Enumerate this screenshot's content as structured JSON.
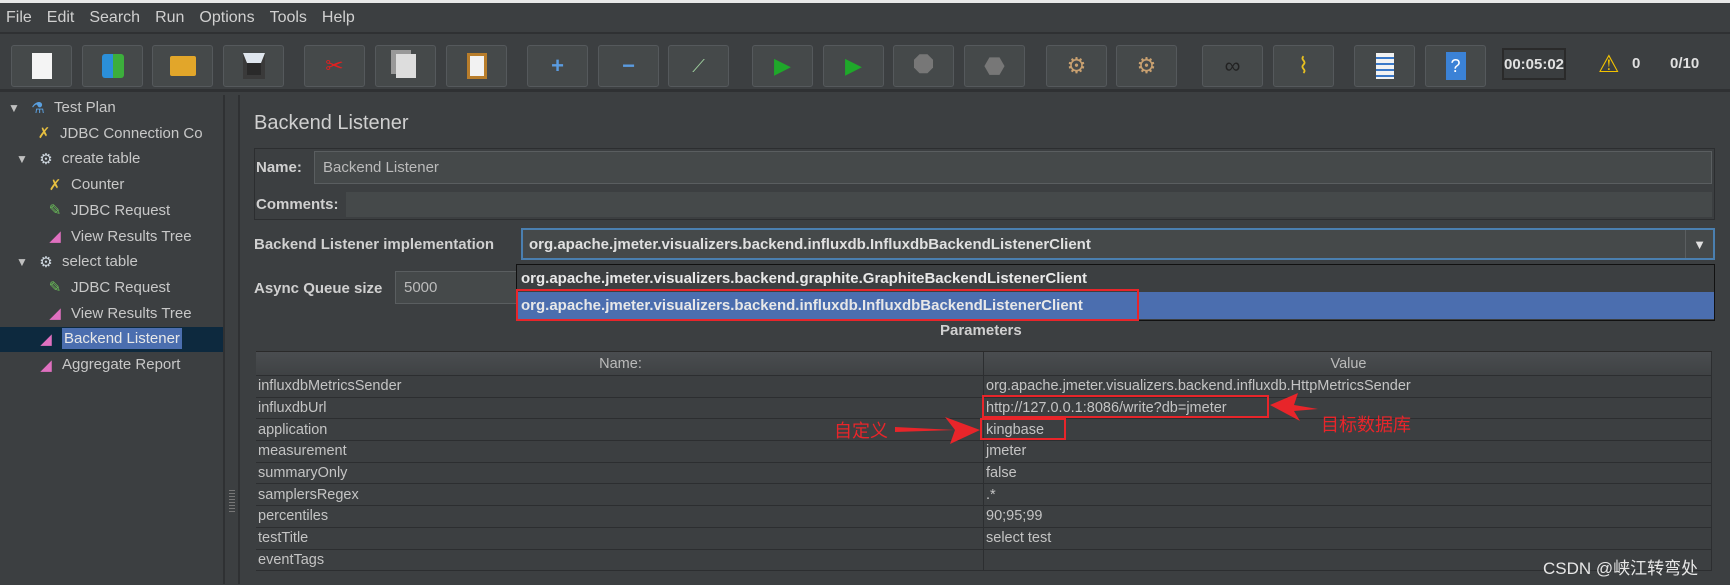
{
  "menu": [
    "File",
    "Edit",
    "Search",
    "Run",
    "Options",
    "Tools",
    "Help"
  ],
  "toolbar": {
    "buttons": [
      "new-icon",
      "templates-icon",
      "open-icon",
      "save-icon",
      "cut-icon",
      "copy-icon",
      "paste-icon",
      "expand-icon",
      "collapse-icon",
      "toggle-icon",
      "start-icon",
      "start-no-pauses-icon",
      "stop-icon",
      "shutdown-icon",
      "clear-icon",
      "clear-all-icon",
      "search-icon",
      "reset-search-icon",
      "function-helper-icon",
      "help-icon"
    ],
    "timer": "00:05:02",
    "warning_count": "0",
    "threads": "0/10"
  },
  "tree": {
    "items": [
      {
        "label": "Test Plan",
        "icon": "test-plan-flask-icon"
      },
      {
        "label": "JDBC Connection Co",
        "icon": "config-wrench-icon"
      },
      {
        "label": "create table",
        "icon": "thread-group-gear-icon"
      },
      {
        "label": "Counter",
        "icon": "config-wrench-icon"
      },
      {
        "label": "JDBC Request",
        "icon": "sampler-pipette-icon"
      },
      {
        "label": "View Results Tree",
        "icon": "listener-chart-icon"
      },
      {
        "label": "select table",
        "icon": "thread-group-gear-icon"
      },
      {
        "label": "JDBC Request",
        "icon": "sampler-pipette-icon"
      },
      {
        "label": "View Results Tree",
        "icon": "listener-chart-icon"
      },
      {
        "label": "Backend Listener",
        "icon": "listener-chart-icon"
      },
      {
        "label": "Aggregate Report",
        "icon": "listener-chart-icon"
      }
    ],
    "selected": "Backend Listener"
  },
  "panel": {
    "title": "Backend Listener",
    "name_label": "Name:",
    "name_value": "Backend Listener",
    "comments_label": "Comments:",
    "impl_label": "Backend Listener implementation",
    "impl_value": "org.apache.jmeter.visualizers.backend.influxdb.InfluxdbBackendListenerClient",
    "impl_options": [
      "org.apache.jmeter.visualizers.backend.graphite.GraphiteBackendListenerClient",
      "org.apache.jmeter.visualizers.backend.influxdb.InfluxdbBackendListenerClient"
    ],
    "queue_label": "Async Queue size",
    "queue_value": "5000",
    "params_label": "Parameters"
  },
  "table": {
    "headers": [
      "Name:",
      "Value"
    ],
    "rows": [
      [
        "influxdbMetricsSender",
        "org.apache.jmeter.visualizers.backend.influxdb.HttpMetricsSender"
      ],
      [
        "influxdbUrl",
        "http://127.0.0.1:8086/write?db=jmeter"
      ],
      [
        "application",
        "kingbase"
      ],
      [
        "measurement",
        "jmeter"
      ],
      [
        "summaryOnly",
        "false"
      ],
      [
        "samplersRegex",
        ".*"
      ],
      [
        "percentiles",
        "90;95;99"
      ],
      [
        "testTitle",
        "select test"
      ],
      [
        "eventTags",
        ""
      ]
    ]
  },
  "annotations": {
    "custom": "自定义",
    "target_db": "目标数据库",
    "color": "#e8252a"
  },
  "watermark": "CSDN @峡江转弯处"
}
